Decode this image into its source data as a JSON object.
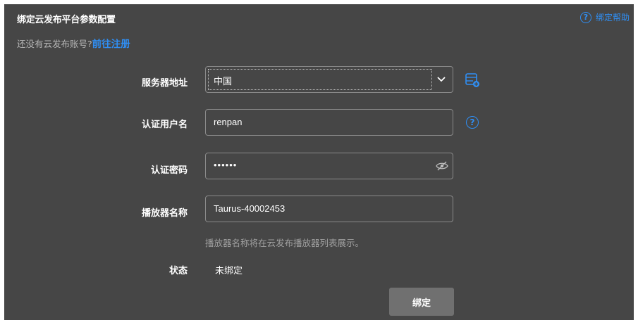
{
  "header": {
    "title": "绑定云发布平台参数配置",
    "help_label": "绑定帮助",
    "help_icon": "question-circle-icon"
  },
  "register": {
    "prompt": "还没有云发布账号?",
    "link": "前往注册"
  },
  "form": {
    "server": {
      "label": "服务器地址",
      "value": "中国",
      "add_icon": "server-add-icon"
    },
    "username": {
      "label": "认证用户名",
      "value": "renpan",
      "help_icon": "question-circle-icon"
    },
    "password": {
      "label": "认证密码",
      "value": "••••••",
      "toggle_icon": "eye-slash-icon"
    },
    "player_name": {
      "label": "播放器名称",
      "value": "Taurus-40002453",
      "hint": "播放器名称将在云发布播放器列表展示。"
    },
    "status": {
      "label": "状态",
      "value": "未绑定"
    }
  },
  "actions": {
    "bind_label": "绑定"
  },
  "colors": {
    "background": "#464646",
    "accent": "#2f8ff5",
    "field_border": "#8a8a8a",
    "button": "#707070"
  }
}
